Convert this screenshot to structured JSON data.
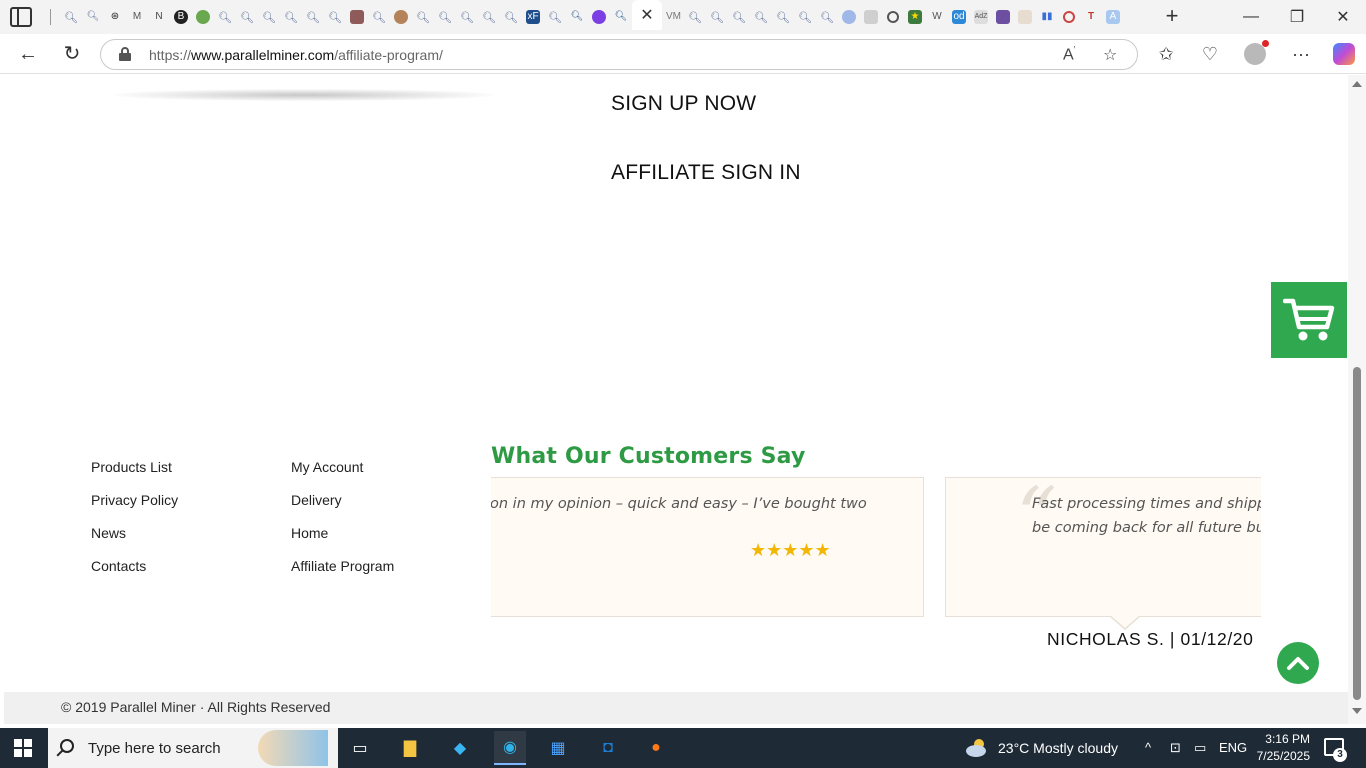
{
  "browser": {
    "url_prefix": "https://",
    "url_host": "www.parallelminer.com",
    "url_path": "/affiliate-program/"
  },
  "page": {
    "cta_signup": "SIGN UP NOW",
    "cta_signin": "AFFILIATE SIGN IN",
    "footer_links_col1": [
      "Products List",
      "Privacy Policy",
      "News",
      "Contacts"
    ],
    "footer_links_col2": [
      "My Account",
      "Delivery",
      "Home",
      "Affiliate Program"
    ],
    "testimonials_title": "What Our Customers Say",
    "testimonial_1_text": "on in my opinion – quick and easy – I’ve bought two",
    "testimonial_1_stars": "★★★★★",
    "testimonial_2_line1": "Fast processing times and shippin",
    "testimonial_2_line2": "be coming back for all future buil",
    "testimonial_2_author": "NICHOLAS S. | 01/12/20",
    "copyright": "© 2019 Parallel Miner · All Rights Reserved",
    "accent_color": "#2fa84f",
    "title_color": "#2e9b44"
  },
  "taskbar": {
    "search_placeholder": "Type here to search",
    "weather": "23°C  Mostly cloudy",
    "language": "ENG",
    "time": "3:16 PM",
    "date": "7/25/2025",
    "notifications": "3"
  }
}
